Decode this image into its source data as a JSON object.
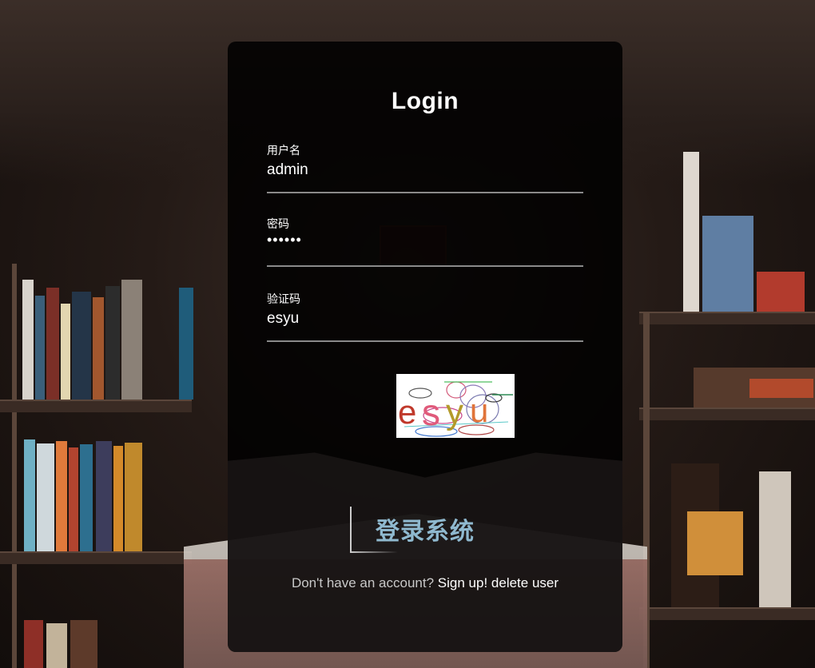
{
  "login": {
    "title": "Login",
    "username_label": "用户名",
    "username_value": "admin",
    "password_label": "密码",
    "password_value": "••••••",
    "captcha_label": "验证码",
    "captcha_value": "esyu",
    "captcha_image_text": "esyu",
    "submit_label": "登录系统",
    "footer_prompt": "Don't have an account?",
    "signup_link": "Sign up!",
    "delete_link": "delete user"
  },
  "colors": {
    "card_bg": "#000000",
    "button_text": "#8fb9cf",
    "underline": "#8a8a8a"
  }
}
